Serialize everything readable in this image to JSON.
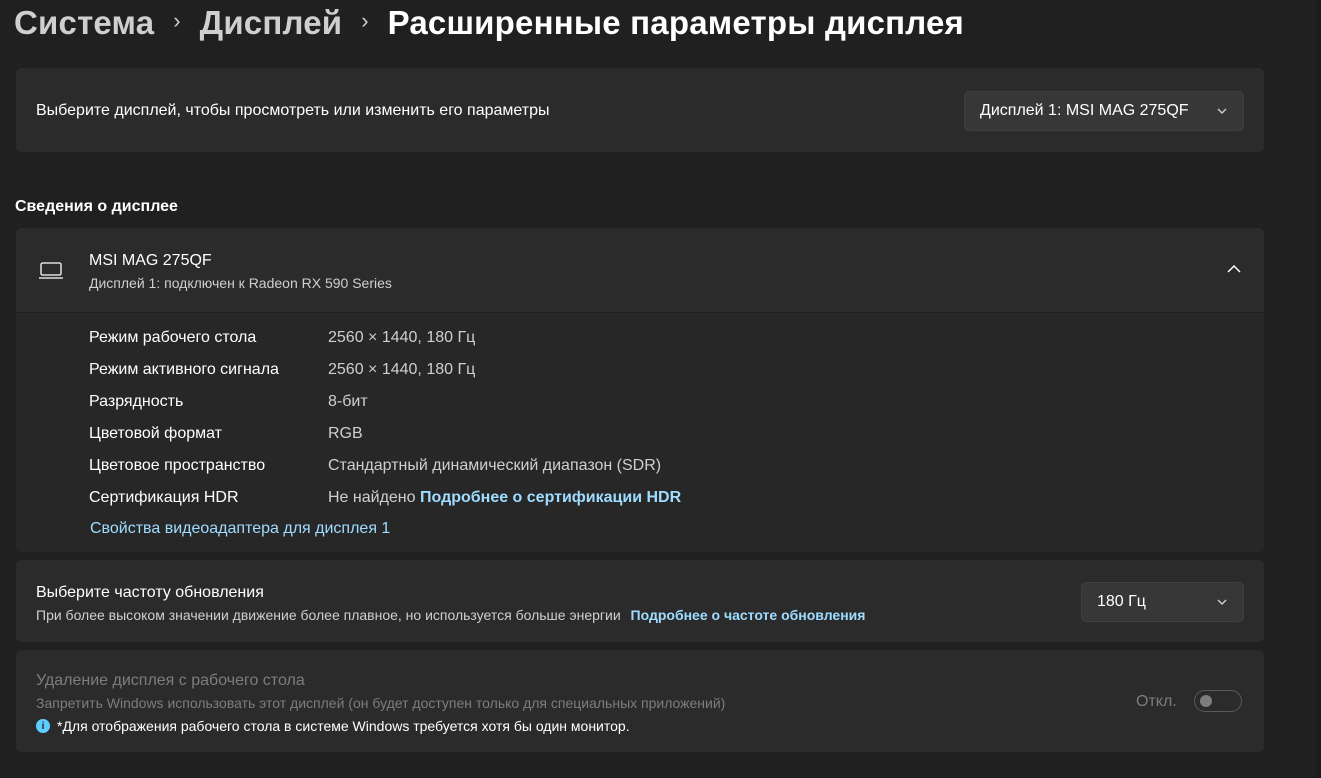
{
  "breadcrumb": {
    "items": [
      "Система",
      "Дисплей"
    ],
    "separator": "›",
    "current": "Расширенные параметры дисплея"
  },
  "select_display": {
    "label": "Выберите дисплей, чтобы просмотреть или изменить его параметры",
    "dropdown_value": "Дисплей 1: MSI MAG 275QF"
  },
  "display_info": {
    "section_title": "Сведения о дисплее",
    "monitor_name": "MSI MAG 275QF",
    "monitor_subtitle": "Дисплей 1: подключен к Radeon RX 590 Series",
    "rows": [
      {
        "key": "Режим рабочего стола",
        "value": "2560 × 1440, 180 Гц"
      },
      {
        "key": "Режим активного сигнала",
        "value": "2560 × 1440, 180 Гц"
      },
      {
        "key": "Разрядность",
        "value": "8-бит"
      },
      {
        "key": "Цветовой формат",
        "value": "RGB"
      },
      {
        "key": "Цветовое пространство",
        "value": "Стандартный динамический диапазон (SDR)"
      },
      {
        "key": "Сертификация HDR",
        "value": "Не найдено",
        "link": "Подробнее о сертификации HDR"
      }
    ],
    "adapter_link": "Свойства видеоадаптера для дисплея 1"
  },
  "refresh_rate": {
    "title": "Выберите частоту обновления",
    "description": "При более высоком значении движение более плавное, но используется больше энергии",
    "link": "Подробнее о частоте обновления",
    "dropdown_value": "180 Гц"
  },
  "remove_display": {
    "title": "Удаление дисплея с рабочего стола",
    "description": "Запретить Windows использовать этот дисплей (он будет доступен только для специальных приложений)",
    "note": "*Для отображения рабочего стола в системе Windows требуется хотя бы один монитор.",
    "note_icon": "i",
    "toggle_label": "Откл.",
    "toggle_on": false
  },
  "colors": {
    "background": "#202020",
    "card": "#2b2b2b",
    "accent_link": "#9fdcff",
    "info_icon": "#60cdff"
  }
}
